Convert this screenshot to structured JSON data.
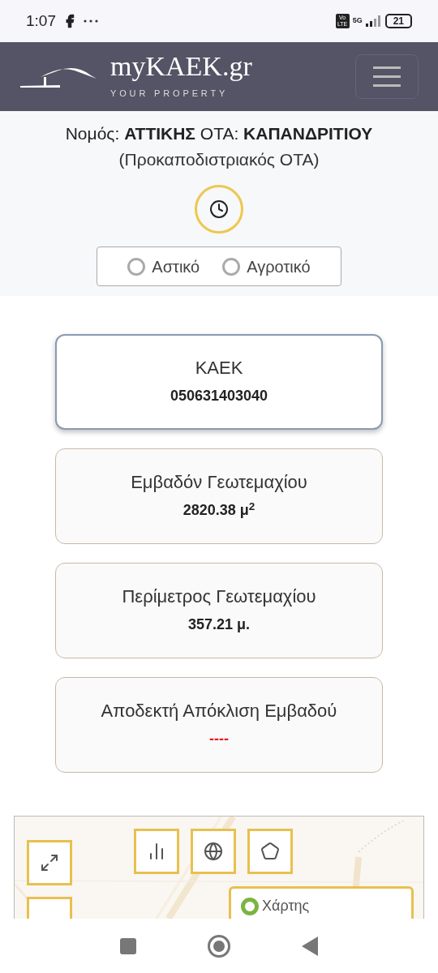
{
  "status_bar": {
    "time": "1:07",
    "volte": "Vo LTE",
    "network": "5G",
    "battery": "21"
  },
  "header": {
    "brand": "myKAEK.gr",
    "tagline": "YOUR PROPERTY"
  },
  "location": {
    "line": "Νομός: **ΑΤΤΙΚΗΣ** ΟΤΑ: **ΚΑΠΑΝΔΡΙΤΙΟΥ**",
    "subline": "(Προκαποδιστριακός ΟΤΑ)"
  },
  "area_type": [
    {
      "label": "Αστικό",
      "selected": false
    },
    {
      "label": "Αγροτικό",
      "selected": false
    }
  ],
  "cards": [
    {
      "title": "ΚΑΕΚ",
      "value": "050631403040",
      "selected": true,
      "kind": "value"
    },
    {
      "title": "Εμβαδόν Γεωτεμαχίου",
      "value": "2820.38 μ$^{2}$",
      "selected": false,
      "kind": "value"
    },
    {
      "title": "Περίμετρος Γεωτεμαχίου",
      "value": "357.21 μ.",
      "selected": false,
      "kind": "value"
    },
    {
      "title": "Αποδεκτή Απόκλιση Εμβαδού",
      "value": "----",
      "selected": false,
      "kind": "missing"
    }
  ],
  "map": {
    "layer_label": "Χάρτης"
  }
}
